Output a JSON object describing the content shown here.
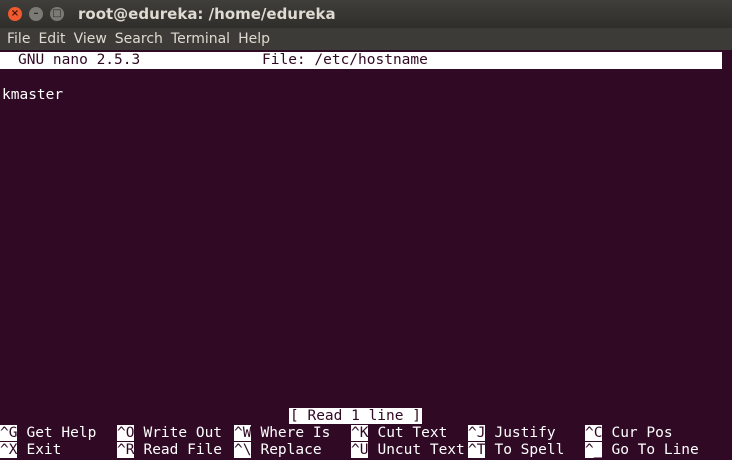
{
  "window": {
    "title": "root@edureka: /home/edureka",
    "close_glyph": "×",
    "min_glyph": "–",
    "max_glyph": "□"
  },
  "menu": [
    "File",
    "Edit",
    "View",
    "Search",
    "Terminal",
    "Help"
  ],
  "nano": {
    "version": "GNU nano 2.5.3",
    "file_label": "File: /etc/hostname",
    "lines": [
      "kmaster"
    ],
    "status": "[ Read 1 line ]"
  },
  "shortcuts": {
    "row1": [
      {
        "key": "^G",
        "label": "Get Help"
      },
      {
        "key": "^O",
        "label": "Write Out"
      },
      {
        "key": "^W",
        "label": "Where Is"
      },
      {
        "key": "^K",
        "label": "Cut Text"
      },
      {
        "key": "^J",
        "label": "Justify"
      },
      {
        "key": "^C",
        "label": "Cur Pos"
      }
    ],
    "row2": [
      {
        "key": "^X",
        "label": "Exit"
      },
      {
        "key": "^R",
        "label": "Read File"
      },
      {
        "key": "^\\",
        "label": "Replace"
      },
      {
        "key": "^U",
        "label": "Uncut Text"
      },
      {
        "key": "^T",
        "label": "To Spell"
      },
      {
        "key": "^_",
        "label": "Go To Line"
      }
    ]
  },
  "colors": {
    "background": "#300a24",
    "titlebar": "#3c3b37",
    "close": "#ef5a2f"
  }
}
